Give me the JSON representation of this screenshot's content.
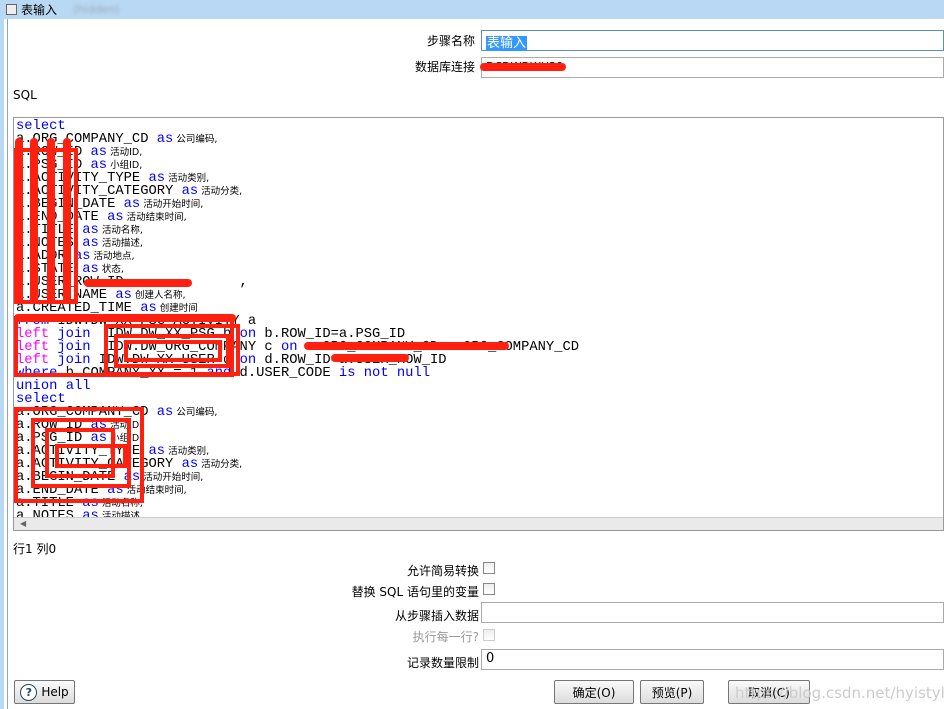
{
  "window": {
    "title": "表输入",
    "subtitle_blurred": "(hidden)"
  },
  "form": {
    "step_name_label": "步骤名称",
    "step_name_value": "表输入",
    "connection_label": "数据库连接",
    "connection_value": "DCDWDWH20",
    "sql_label": "SQL",
    "cursor_position": "行1 列0",
    "lazy_conversion_label": "允许简易转换",
    "lazy_conversion_checked": false,
    "replace_variables_label": "替换 SQL 语句里的变量",
    "replace_variables_checked": false,
    "insert_from_step_label": "从步骤插入数据",
    "insert_from_step_value": "",
    "execute_each_row_label": "执行每一行?",
    "execute_each_row_checked": false,
    "limit_label": "记录数量限制",
    "limit_value": "0"
  },
  "sql_lines": [
    [
      [
        "select",
        "k"
      ]
    ],
    [
      [
        "a.ORG_COMPANY_CD ",
        ""
      ],
      [
        "as",
        "k"
      ],
      [
        " 公司编码,",
        "c"
      ]
    ],
    [
      [
        "a.ROW_ID ",
        ""
      ],
      [
        "as",
        "k"
      ],
      [
        " 活动ID,",
        "c"
      ]
    ],
    [
      [
        "a.PSG_ID ",
        ""
      ],
      [
        "as",
        "k"
      ],
      [
        " 小组ID,",
        "c"
      ]
    ],
    [
      [
        "a.ACTIVITY_TYPE ",
        ""
      ],
      [
        "as",
        "k"
      ],
      [
        " 活动类别,",
        "c"
      ]
    ],
    [
      [
        "a.ACTIVITY_CATEGORY ",
        ""
      ],
      [
        "as",
        "k"
      ],
      [
        " 活动分类,",
        "c"
      ]
    ],
    [
      [
        "a.BEGIN_DATE ",
        ""
      ],
      [
        "as",
        "k"
      ],
      [
        " 活动开始时间,",
        "c"
      ]
    ],
    [
      [
        "a.END_DATE ",
        ""
      ],
      [
        "as",
        "k"
      ],
      [
        " 活动结束时间,",
        "c"
      ]
    ],
    [
      [
        "a.TITLE ",
        ""
      ],
      [
        "as",
        "k"
      ],
      [
        " 活动名称,",
        "c"
      ]
    ],
    [
      [
        "a.NOTES ",
        ""
      ],
      [
        "as",
        "k"
      ],
      [
        " 活动描述,",
        "c"
      ]
    ],
    [
      [
        "a.ADDR ",
        ""
      ],
      [
        "as",
        "k"
      ],
      [
        " 活动地点,",
        "c"
      ]
    ],
    [
      [
        "a.STATE ",
        ""
      ],
      [
        "as",
        "k"
      ],
      [
        " 状态,",
        "c"
      ]
    ],
    [
      [
        "a.USER_ROW_ID              ,",
        ""
      ]
    ],
    [
      [
        "a.USER_NAME ",
        ""
      ],
      [
        "as",
        "k"
      ],
      [
        " 创建人名称,",
        "c"
      ]
    ],
    [
      [
        "a.CREATED_TIME ",
        ""
      ],
      [
        "as",
        "k"
      ],
      [
        " 创建时间",
        "c"
      ]
    ],
    [
      [
        "from",
        "k"
      ],
      [
        " IDW.DW_XX_PSG_ACTIVITY a",
        ""
      ]
    ],
    [
      [
        "left",
        "m"
      ],
      [
        " ",
        ""
      ],
      [
        "join",
        "k"
      ],
      [
        "  IDW.DW_XX_PSG b ",
        ""
      ],
      [
        "on",
        "k"
      ],
      [
        " b.ROW_ID=a.PSG_ID",
        ""
      ]
    ],
    [
      [
        "left",
        "m"
      ],
      [
        " ",
        ""
      ],
      [
        "join",
        "k"
      ],
      [
        "  IDW.DW_ORG_COMPANY c ",
        ""
      ],
      [
        "on",
        "k"
      ],
      [
        " c.ORG_COMPANY_CD=a.ORG_COMPANY_CD",
        ""
      ]
    ],
    [
      [
        "left",
        "m"
      ],
      [
        " ",
        ""
      ],
      [
        "join",
        "k"
      ],
      [
        " IDW.DW_XX_USER d ",
        ""
      ],
      [
        "on",
        "k"
      ],
      [
        " d.ROW_ID=a.USER_ROW_ID",
        ""
      ]
    ],
    [
      [
        "where",
        "k"
      ],
      [
        " b.COMPANY_XX = 1 ",
        ""
      ],
      [
        "and",
        "k"
      ],
      [
        " d.USER_CODE ",
        ""
      ],
      [
        "is",
        "k"
      ],
      [
        " ",
        ""
      ],
      [
        "not",
        "k"
      ],
      [
        " ",
        ""
      ],
      [
        "null",
        "k"
      ]
    ],
    [
      [
        "union",
        "k"
      ],
      [
        " ",
        ""
      ],
      [
        "all",
        "k"
      ]
    ],
    [
      [
        "select",
        "k"
      ]
    ],
    [
      [
        "a.ORG_COMPANY_CD ",
        ""
      ],
      [
        "as",
        "k"
      ],
      [
        " 公司编码,",
        "c"
      ]
    ],
    [
      [
        "a.ROW_ID ",
        ""
      ],
      [
        "as",
        "k"
      ],
      [
        " 活动ID,",
        "c"
      ]
    ],
    [
      [
        "a.PSG_ID ",
        ""
      ],
      [
        "as",
        "k"
      ],
      [
        " 小组ID,",
        "c"
      ]
    ],
    [
      [
        "a.ACTIVITY_TYPE ",
        ""
      ],
      [
        "as",
        "k"
      ],
      [
        " 活动类别,",
        "c"
      ]
    ],
    [
      [
        "a.ACTIVITY_CATEGORY ",
        ""
      ],
      [
        "as",
        "k"
      ],
      [
        " 活动分类,",
        "c"
      ]
    ],
    [
      [
        "a.BEGIN_DATE ",
        ""
      ],
      [
        "as",
        "k"
      ],
      [
        " 活动开始时间,",
        "c"
      ]
    ],
    [
      [
        "a.END_DATE ",
        ""
      ],
      [
        "as",
        "k"
      ],
      [
        " 活动结束时间,",
        "c"
      ]
    ],
    [
      [
        "a.TITLE ",
        ""
      ],
      [
        "as",
        "k"
      ],
      [
        " 活动名称,",
        "c"
      ]
    ],
    [
      [
        "a.NOTES ",
        ""
      ],
      [
        "as",
        "k"
      ],
      [
        " 活动描述,",
        "c"
      ]
    ]
  ],
  "buttons": {
    "help": "Help",
    "ok": "确定(O)",
    "preview": "预览(P)",
    "cancel": "取消(C)"
  },
  "watermark": "https://blog.csdn.net/hyistyle",
  "colors": {
    "keyword": "#0000ff",
    "left_keyword": "#ff00ff",
    "redaction": "#ff2010",
    "selection": "#3399ff"
  }
}
